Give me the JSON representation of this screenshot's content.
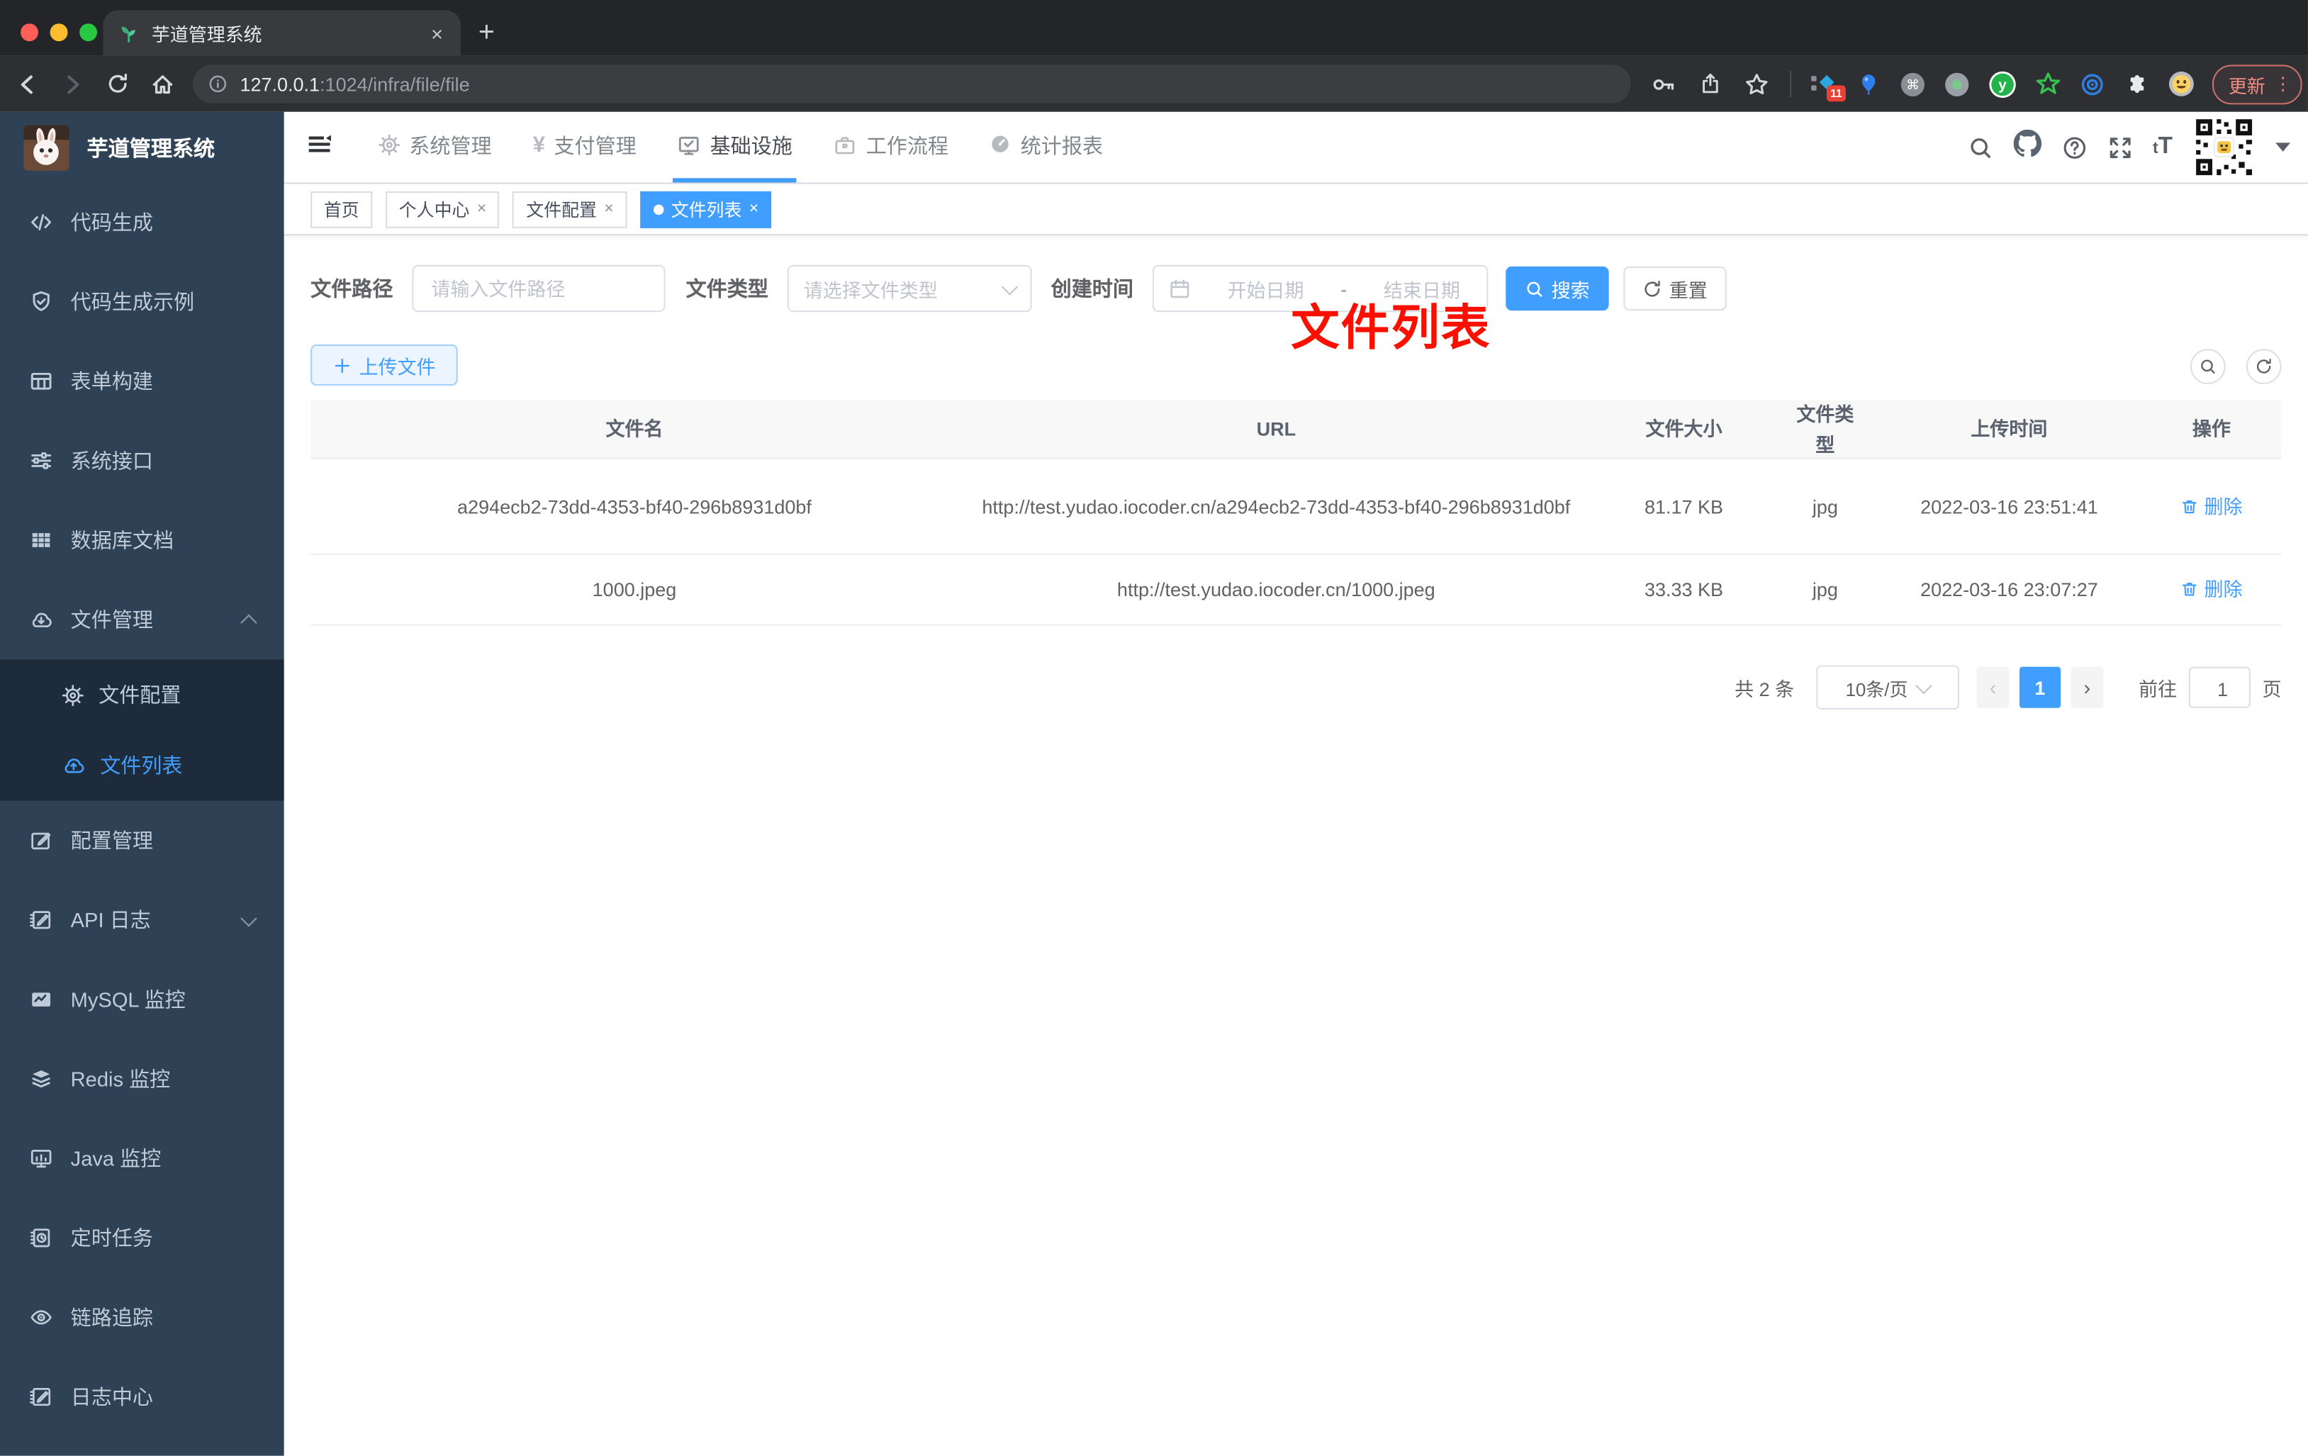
{
  "colors": {
    "accent": "#409eff",
    "annotation_red": "#fb1000",
    "update_button": "#f28b82",
    "sidebar_bg": "#2f4154",
    "submenu_bg": "#1e2b3a"
  },
  "browser": {
    "tab_title": "芋道管理系统",
    "close_glyph": "×",
    "new_tab_glyph": "+",
    "url_host": "127.0.0.1",
    "url_rest": ":1024/infra/file/file",
    "extension_badge": "11",
    "cmd_glyph": "⌘",
    "ext_letter": "y",
    "update_label": "更新",
    "menu_glyph": "⋮"
  },
  "header": {
    "nav_items": [
      {
        "label": "系统管理"
      },
      {
        "label": "支付管理"
      },
      {
        "label": "基础设施"
      },
      {
        "label": "工作流程"
      },
      {
        "label": "统计报表"
      }
    ],
    "yen_glyph": "¥",
    "font_small": "t",
    "font_large": "T"
  },
  "sidebar": {
    "logo_title": "芋道管理系统",
    "items": [
      {
        "label": "代码生成"
      },
      {
        "label": "代码生成示例"
      },
      {
        "label": "表单构建"
      },
      {
        "label": "系统接口"
      },
      {
        "label": "数据库文档"
      },
      {
        "label": "文件管理"
      },
      {
        "label": "配置管理"
      },
      {
        "label": "API 日志"
      },
      {
        "label": "MySQL 监控"
      },
      {
        "label": "Redis 监控"
      },
      {
        "label": "Java 监控"
      },
      {
        "label": "定时任务"
      },
      {
        "label": "链路追踪"
      },
      {
        "label": "日志中心"
      }
    ],
    "submenu": [
      {
        "label": "文件配置"
      },
      {
        "label": "文件列表"
      }
    ]
  },
  "tags": {
    "items": [
      {
        "label": "首页"
      },
      {
        "label": "个人中心"
      },
      {
        "label": "文件配置"
      },
      {
        "label": "文件列表"
      }
    ],
    "close_glyph": "×"
  },
  "annotation": {
    "text": "文件列表"
  },
  "filters": {
    "path_label": "文件路径",
    "path_placeholder": "请输入文件路径",
    "type_label": "文件类型",
    "type_placeholder": "请选择文件类型",
    "date_label": "创建时间",
    "date_start_placeholder": "开始日期",
    "date_separator": "-",
    "date_end_placeholder": "结束日期",
    "search_label": "搜索",
    "reset_label": "重置"
  },
  "toolbar": {
    "upload_label": "上传文件"
  },
  "table": {
    "headers": [
      "文件名",
      "URL",
      "文件大小",
      "文件类型",
      "上传时间",
      "操作"
    ],
    "rows": [
      {
        "name": "a294ecb2-73dd-4353-bf40-296b8931d0bf",
        "url": "http://test.yudao.iocoder.cn/a294ecb2-73dd-4353-bf40-296b8931d0bf",
        "size": "81.17 KB",
        "type": "jpg",
        "time": "2022-03-16 23:51:41"
      },
      {
        "name": "1000.jpeg",
        "url": "http://test.yudao.iocoder.cn/1000.jpeg",
        "size": "33.33 KB",
        "type": "jpg",
        "time": "2022-03-16 23:07:27"
      }
    ],
    "delete_label": "删除"
  },
  "pagination": {
    "total": "共 2 条",
    "page_size": "10条/页",
    "prev_glyph": "‹",
    "current_page": "1",
    "next_glyph": "›",
    "goto_label": "前往",
    "goto_value": "1",
    "unit_label": "页"
  }
}
